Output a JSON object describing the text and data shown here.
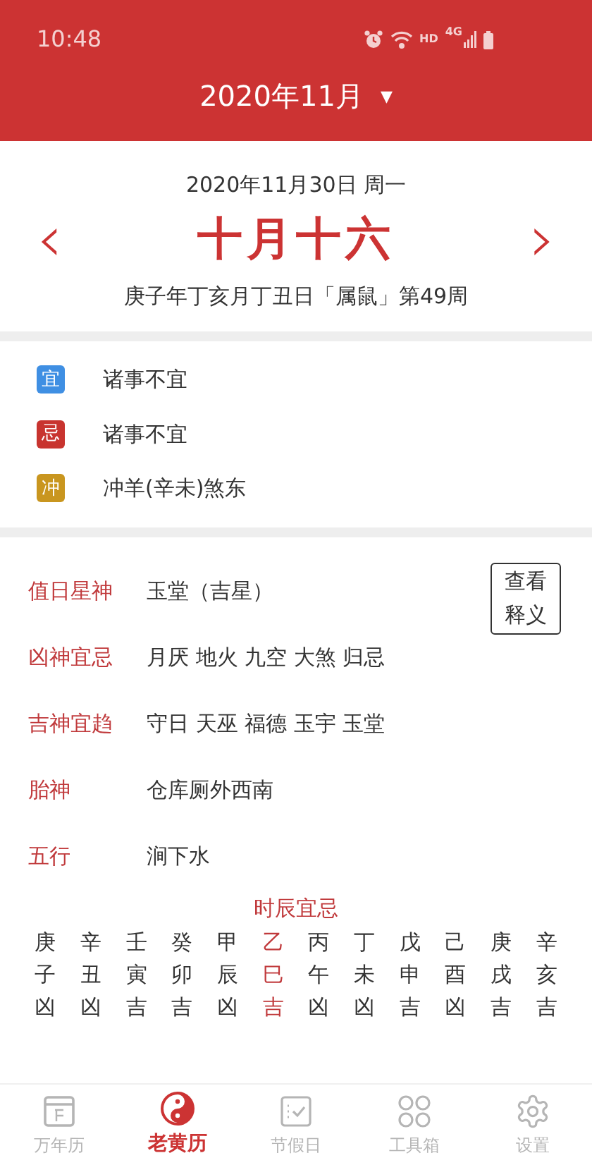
{
  "status_bar": {
    "time": "10:48",
    "hd": "HD",
    "network": "4G"
  },
  "header": {
    "title": "2020年11月",
    "caret": "▼"
  },
  "date": {
    "solar": "2020年11月30日 周一",
    "lunar": "十月十六",
    "prev": "‹",
    "next": "›",
    "ganzhi": "庚子年丁亥月丁丑日「属鼠」第49周"
  },
  "omens": [
    {
      "tag": "宜",
      "color": "#3f8fe3",
      "text": "诸事不宜"
    },
    {
      "tag": "忌",
      "color": "#c8342f",
      "text": "诸事不宜"
    },
    {
      "tag": "冲",
      "color": "#c9961f",
      "text": "冲羊(辛未)煞东"
    }
  ],
  "details": [
    {
      "label": "值日星神",
      "value": "玉堂（吉星）"
    },
    {
      "label": "凶神宜忌",
      "value": "月厌 地火 九空 大煞 归忌"
    },
    {
      "label": "吉神宜趋",
      "value": "守日 天巫 福德 玉宇 玉堂"
    },
    {
      "label": "胎神",
      "value": "仓库厕外西南"
    },
    {
      "label": "五行",
      "value": "涧下水"
    }
  ],
  "explain_button": [
    "查看",
    "释义"
  ],
  "hours": {
    "title": "时辰宜忌",
    "columns": [
      {
        "stem": "庚",
        "branch": "子",
        "luck": "凶",
        "selected": false
      },
      {
        "stem": "辛",
        "branch": "丑",
        "luck": "凶",
        "selected": false
      },
      {
        "stem": "壬",
        "branch": "寅",
        "luck": "吉",
        "selected": false
      },
      {
        "stem": "癸",
        "branch": "卯",
        "luck": "吉",
        "selected": false
      },
      {
        "stem": "甲",
        "branch": "辰",
        "luck": "凶",
        "selected": false
      },
      {
        "stem": "乙",
        "branch": "巳",
        "luck": "吉",
        "selected": true
      },
      {
        "stem": "丙",
        "branch": "午",
        "luck": "凶",
        "selected": false
      },
      {
        "stem": "丁",
        "branch": "未",
        "luck": "凶",
        "selected": false
      },
      {
        "stem": "戊",
        "branch": "申",
        "luck": "吉",
        "selected": false
      },
      {
        "stem": "己",
        "branch": "酉",
        "luck": "凶",
        "selected": false
      },
      {
        "stem": "庚",
        "branch": "戌",
        "luck": "吉",
        "selected": false
      },
      {
        "stem": "辛",
        "branch": "亥",
        "luck": "吉",
        "selected": false
      }
    ]
  },
  "tabs": [
    {
      "label": "万年历",
      "selected": false
    },
    {
      "label": "老黄历",
      "selected": true
    },
    {
      "label": "节假日",
      "selected": false
    },
    {
      "label": "工具箱",
      "selected": false
    },
    {
      "label": "设置",
      "selected": false
    }
  ]
}
